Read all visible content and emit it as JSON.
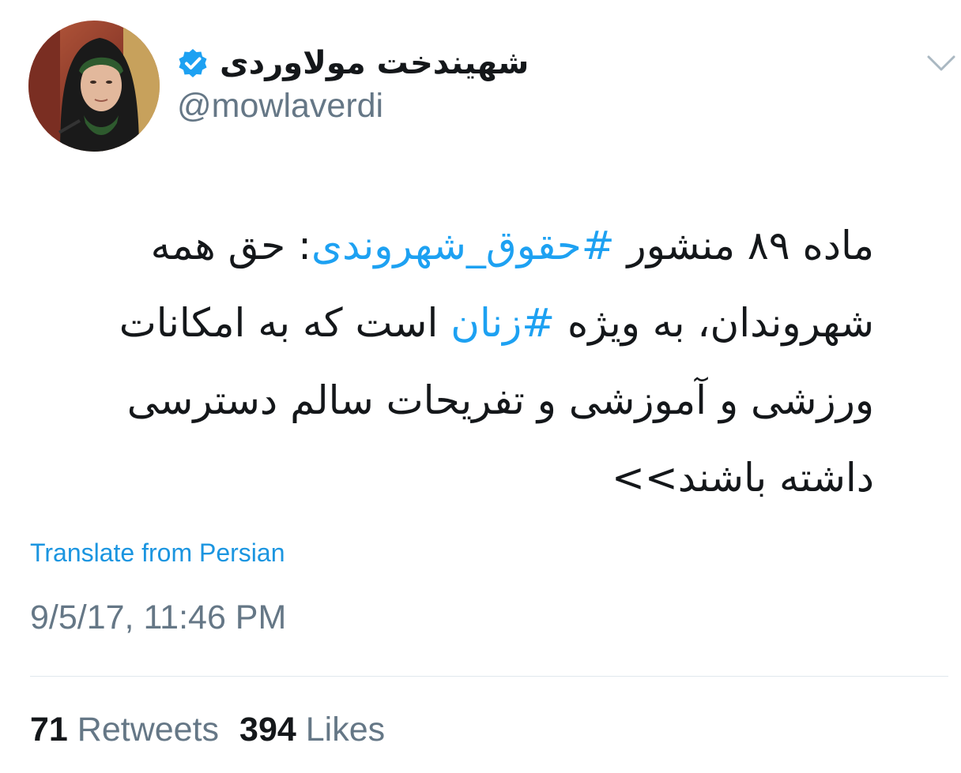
{
  "tweet": {
    "author": {
      "display_name": "شهیندخت مولاوردی",
      "handle": "@mowlaverdi",
      "verified": true,
      "avatar_icon": "profile-photo"
    },
    "menu_icon": "chevron-down-icon",
    "text": {
      "segments": [
        {
          "type": "text",
          "value": "ماده ۸۹ منشور "
        },
        {
          "type": "hashtag",
          "value": "#حقوق_شهروندی"
        },
        {
          "type": "text",
          "value": ": حق همه شهروندان، به ویژه "
        },
        {
          "type": "hashtag",
          "value": "#زنان"
        },
        {
          "type": "text",
          "value": " است که به امکانات ورزشی و آموزشی و تفریحات سالم دسترسی داشته باشند>>"
        }
      ]
    },
    "translate_label": "Translate from Persian",
    "timestamp": "9/5/17, 11:46 PM",
    "stats": {
      "retweets_count": "71",
      "retweets_label": "Retweets",
      "likes_count": "394",
      "likes_label": "Likes"
    },
    "colors": {
      "link": "#1da1f2",
      "secondary_text": "#657786",
      "primary_text": "#14171a",
      "divider": "#e1e8ed"
    }
  }
}
